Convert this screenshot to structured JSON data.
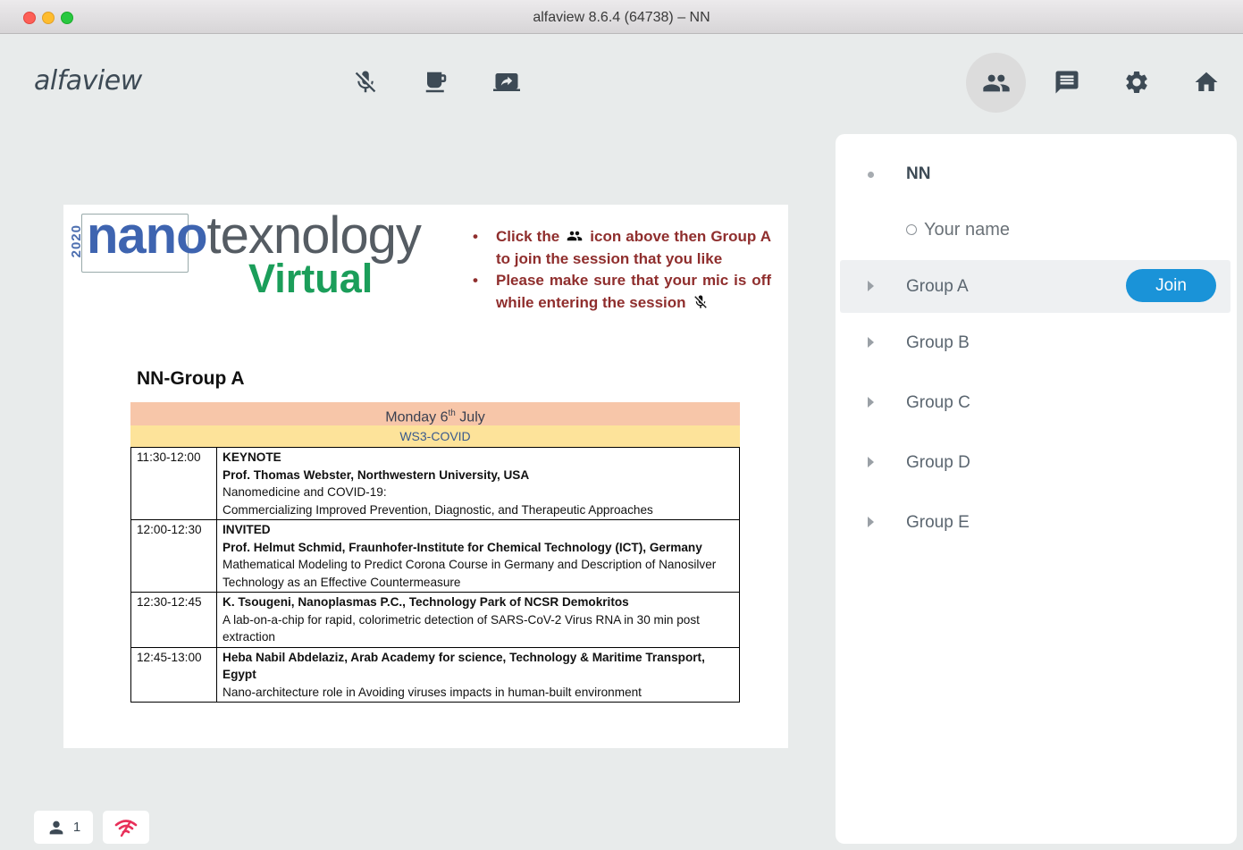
{
  "window": {
    "title": "alfaview 8.6.4 (64738) – NN"
  },
  "toolbar": {
    "logo": "alfaview",
    "icons": [
      "mic-off-icon",
      "coffee-icon",
      "screen-share-icon",
      "participants-icon",
      "chat-icon",
      "settings-icon",
      "home-icon"
    ]
  },
  "slide": {
    "year": "2020",
    "brand_prefix": "nano",
    "brand_suffix": "texnology",
    "brand_sub": "Virtual",
    "bullet1_a": "Click the",
    "bullet1_b": "icon above then Group A to join the session that you like",
    "bullet2": "Please make sure that your mic is off while entering the session",
    "heading": "NN-Group A",
    "day": "Monday 6",
    "day_sup": "th",
    "day_suffix": " July",
    "ws": "WS3-COVID",
    "rows": [
      {
        "time": "11:30-12:00",
        "type": "KEYNOTE",
        "speaker": "Prof. Thomas Webster, Northwestern University, USA",
        "title": "Nanomedicine and COVID-19:",
        "title2": "Commercializing Improved Prevention, Diagnostic, and Therapeutic Approaches"
      },
      {
        "time": "12:00-12:30",
        "type": "INVITED",
        "speaker": "Prof. Helmut Schmid, Fraunhofer-Institute for Chemical Technology (ICT), Germany",
        "title": "Mathematical Modeling to Predict Corona Course in Germany and Description of Nanosilver Technology as an Effective Countermeasure"
      },
      {
        "time": "12:30-12:45",
        "speaker": "K. Tsougeni, Nanoplasmas P.C., Technology Park of NCSR Demokritos",
        "title": "A lab-on-a-chip for rapid, colorimetric detection of SARS-CoV-2 Virus RNA in 30 min post extraction"
      },
      {
        "time": "12:45-13:00",
        "speaker": "Heba Nabil Abdelaziz, Arab Academy for science, Technology & Maritime Transport, Egypt",
        "title": "Nano-architecture role in Avoiding viruses impacts in human-built environment"
      }
    ]
  },
  "panel": {
    "me": "NN",
    "name_placeholder": "Your name",
    "join_label": "Join",
    "groups": [
      "Group A",
      "Group B",
      "Group C",
      "Group D",
      "Group E"
    ]
  },
  "status": {
    "participants": "1"
  },
  "colors": {
    "accent": "#1a93d8",
    "network": "#e8305a"
  }
}
